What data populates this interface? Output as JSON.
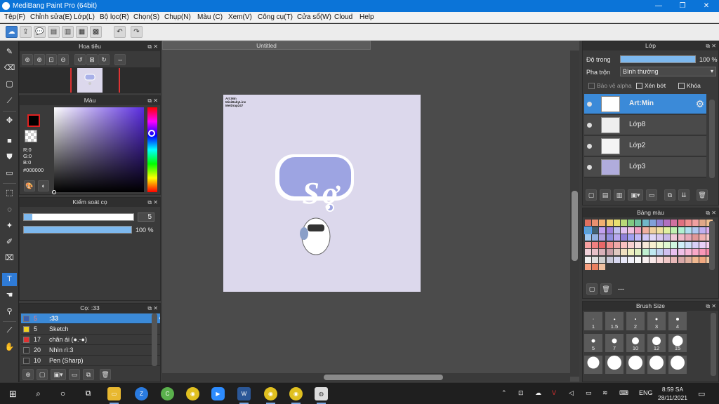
{
  "window": {
    "title": "MediBang Paint Pro (64bit)",
    "min_label": "—",
    "max_label": "❐",
    "close_label": "✕"
  },
  "menu": {
    "items": [
      "Tệp(F)",
      "Chỉnh sửa(E)",
      "Lớp(L)",
      "Bộ lọc(R)",
      "Chọn(S)",
      "Chụp(N)",
      "Màu (C)",
      "Xem(V)",
      "Công cụ(T)",
      "Cửa sổ(W)",
      "Cloud",
      "Help"
    ]
  },
  "navigator": {
    "title": "Hoa tiêu"
  },
  "color": {
    "title": "Màu",
    "r": "R:0",
    "g": "G:0",
    "b": "B:0",
    "hex": "#000000"
  },
  "brush_control": {
    "title": "Kiểm soát cọ",
    "size": "5",
    "opacity": "100 %",
    "opacity_fraction": 1.0
  },
  "brushes": {
    "title": "Cọ: :33",
    "items": [
      {
        "color": "#3a5fb0",
        "size": "5",
        "name": ":33",
        "selected": true
      },
      {
        "color": "#f0d020",
        "size": "5",
        "name": "Sketch"
      },
      {
        "color": "#e03030",
        "size": "17",
        "name": "chân ái (●.-●)"
      },
      {
        "color": "#333333",
        "size": "20",
        "name": "Nhìn rì:3"
      },
      {
        "color": "#333333",
        "size": "10",
        "name": "Pen (Sharp)"
      }
    ]
  },
  "document": {
    "tab": "Untitled"
  },
  "artwork": {
    "watermark": [
      "Art:Min",
      "MiniBabyLine",
      "MeiDrap247"
    ],
    "lettering": "Sợ"
  },
  "layer": {
    "title": "Lớp",
    "opacity_label": "Độ trong",
    "opacity_value": "100 %",
    "opacity_fraction": 1.0,
    "blend_label": "Pha trộn",
    "blend_value": "Bình thường",
    "protect_alpha": "Bảo vệ alpha",
    "clip": "Xén bớt",
    "lock": "Khóa",
    "items": [
      {
        "name": "Art:Min",
        "selected": true
      },
      {
        "name": "Lớp8"
      },
      {
        "name": "Lớp2"
      },
      {
        "name": "Lớp3"
      }
    ]
  },
  "palette": {
    "title": "Bảng màu",
    "footer_text": "---",
    "colors": [
      "#e07060",
      "#e89070",
      "#f0b070",
      "#f0d070",
      "#e8e070",
      "#b8d878",
      "#80c880",
      "#70c0a0",
      "#70b8c8",
      "#80a0d8",
      "#9080d0",
      "#b070c0",
      "#d070a0",
      "#e07080",
      "#f09090",
      "#f0a0a0",
      "#e0a888",
      "#f0c090",
      "#60a0d0",
      "#406070",
      "#c0a0f0",
      "#a080e0",
      "#c0c0f0",
      "#e0c0f0",
      "#f0c0e0",
      "#f0a0c0",
      "#f0b0a0",
      "#f0d0a0",
      "#f0e0a0",
      "#e0f0a0",
      "#c0f0b0",
      "#b0f0d0",
      "#b0e0f0",
      "#b0c8f0",
      "#c0b0f0",
      "#e0b0f0",
      "#a0c8f0",
      "#90b0e0",
      "#b0a0e0",
      "#9090e0",
      "#b8a8f0",
      "#9080d8",
      "#a0a0f0",
      "#c0b8f8",
      "#d0c8f8",
      "#e0d8f8",
      "#d8c8f0",
      "#c8b8e8",
      "#f0c8d8",
      "#f0b8c8",
      "#e8a8b8",
      "#e09898",
      "#f0b0b0",
      "#f8c8c8",
      "#f8a0a0",
      "#f08080",
      "#e86868",
      "#f09090",
      "#f0a8a8",
      "#f8c0c0",
      "#f8d0d0",
      "#f8e0e0",
      "#f8e8d8",
      "#f8f0d0",
      "#f0f8d0",
      "#e0f8d0",
      "#d0f8e0",
      "#d0f0f8",
      "#d0e0f8",
      "#d8d0f8",
      "#e8d0f8",
      "#f8d0f0",
      "#f0d0d8",
      "#e8c0c8",
      "#d8b0b8",
      "#c8a0a8",
      "#e0c8c0",
      "#f0e0c0",
      "#f0f0c0",
      "#e0f0c0",
      "#c0f0d0",
      "#c0e8f0",
      "#c0d0f0",
      "#d0c0f0",
      "#e8c0f0",
      "#f0c0e8",
      "#f8b8d8",
      "#f8a8c8",
      "#f898b8",
      "#f888a8",
      "#f0f0f0",
      "#e0e0e0",
      "#d0d0d0",
      "#c8c8d8",
      "#d8d8f0",
      "#e8e8f8",
      "#f0f0f8",
      "#f8f8f8",
      "#f8f0f0",
      "#f8e8e8",
      "#f8d8d8",
      "#f0c8c8",
      "#e8b8b8",
      "#d8a8a8",
      "#e0b0a0",
      "#f0b890",
      "#f0a880",
      "#f0c8a0",
      "#f8a080",
      "#e88060",
      "#f0c0a0"
    ]
  },
  "brush_size": {
    "title": "Brush Size",
    "items": [
      {
        "label": "1",
        "size": 1
      },
      {
        "label": "1.5",
        "size": 1.5
      },
      {
        "label": "2",
        "size": 2
      },
      {
        "label": "3",
        "size": 3
      },
      {
        "label": "4",
        "size": 4
      },
      {
        "label": "5",
        "size": 5
      },
      {
        "label": "7",
        "size": 7
      },
      {
        "label": "10",
        "size": 10
      },
      {
        "label": "12",
        "size": 12
      },
      {
        "label": "15",
        "size": 15
      },
      {
        "label": "",
        "size": 17
      },
      {
        "label": "",
        "size": 20
      },
      {
        "label": "",
        "size": 20
      },
      {
        "label": "",
        "size": 20
      },
      {
        "label": "",
        "size": 20
      }
    ]
  },
  "taskbar": {
    "lang": "ENG",
    "time": "8:59 SA",
    "date": "28/11/2021"
  }
}
